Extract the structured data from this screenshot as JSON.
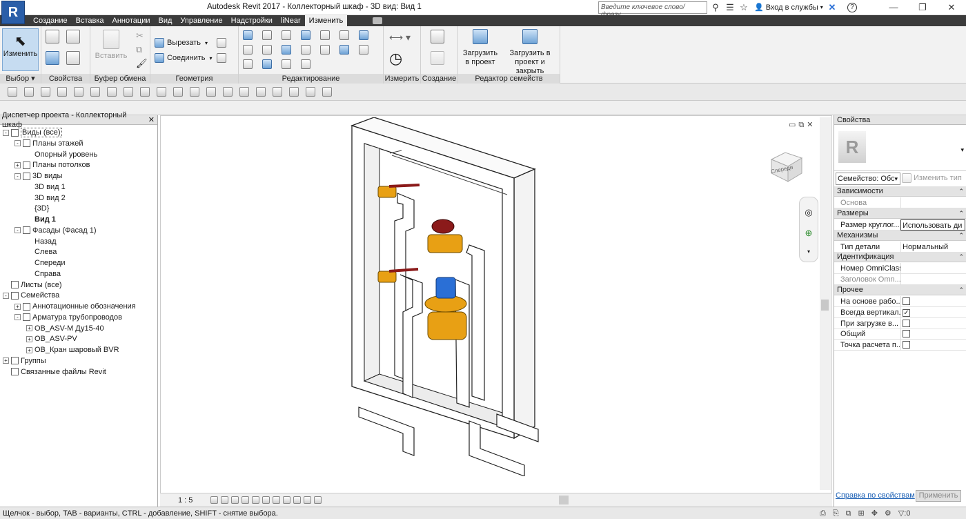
{
  "app": {
    "logo": "R",
    "title": "Autodesk Revit 2017 -      Коллекторный шкаф - 3D вид: Вид 1"
  },
  "search": {
    "placeholder": "Введите ключевое слово/фразу"
  },
  "account": {
    "login": "Вход в службы"
  },
  "tabs": [
    "Создание",
    "Вставка",
    "Аннотации",
    "Вид",
    "Управление",
    "Надстройки",
    "liNear",
    "Изменить"
  ],
  "active_tab": "Изменить",
  "ribbon": {
    "modify_label": "Изменить",
    "paste_label": "Вставить",
    "cut_label": "Вырезать",
    "join_label": "Соединить",
    "load_project_label": "Загрузить в проект",
    "load_close_label": "Загрузить в проект и закрыть",
    "panels": [
      "Выбор",
      "Свойства",
      "Буфер обмена",
      "Геометрия",
      "Редактирование",
      "Измерить",
      "Создание",
      "Редактор семейств"
    ]
  },
  "project_browser": {
    "title": "Диспетчер проекта - Коллекторный шкаф",
    "items": [
      {
        "label": "Виды (все)",
        "level": 0,
        "toggle": "-",
        "bold": false
      },
      {
        "label": "Планы этажей",
        "level": 1,
        "toggle": "-",
        "bold": false
      },
      {
        "label": "Опорный уровень",
        "level": 2,
        "toggle": "",
        "bold": false
      },
      {
        "label": "Планы потолков",
        "level": 1,
        "toggle": "+",
        "bold": false
      },
      {
        "label": "3D виды",
        "level": 1,
        "toggle": "-",
        "bold": false
      },
      {
        "label": "3D вид 1",
        "level": 2,
        "toggle": "",
        "bold": false
      },
      {
        "label": "3D вид 2",
        "level": 2,
        "toggle": "",
        "bold": false
      },
      {
        "label": "{3D}",
        "level": 2,
        "toggle": "",
        "bold": false
      },
      {
        "label": "Вид 1",
        "level": 2,
        "toggle": "",
        "bold": true
      },
      {
        "label": "Фасады (Фасад 1)",
        "level": 1,
        "toggle": "-",
        "bold": false
      },
      {
        "label": "Назад",
        "level": 2,
        "toggle": "",
        "bold": false
      },
      {
        "label": "Слева",
        "level": 2,
        "toggle": "",
        "bold": false
      },
      {
        "label": "Спереди",
        "level": 2,
        "toggle": "",
        "bold": false
      },
      {
        "label": "Справа",
        "level": 2,
        "toggle": "",
        "bold": false
      },
      {
        "label": "Листы (все)",
        "level": 0,
        "toggle": "",
        "bold": false
      },
      {
        "label": "Семейства",
        "level": 0,
        "toggle": "-",
        "bold": false
      },
      {
        "label": "Аннотационные обозначения",
        "level": 1,
        "toggle": "+",
        "bold": false
      },
      {
        "label": "Арматура трубопроводов",
        "level": 1,
        "toggle": "-",
        "bold": false
      },
      {
        "label": "ОВ_ASV-M Ду15-40",
        "level": 2,
        "toggle": "+",
        "bold": false
      },
      {
        "label": "ОВ_ASV-PV",
        "level": 2,
        "toggle": "+",
        "bold": false
      },
      {
        "label": "ОВ_Кран шаровый BVR",
        "level": 2,
        "toggle": "+",
        "bold": false
      },
      {
        "label": "Группы",
        "level": 0,
        "toggle": "+",
        "bold": false
      },
      {
        "label": "Связанные файлы Revit",
        "level": 0,
        "toggle": "",
        "bold": false
      }
    ]
  },
  "viewport": {
    "viewcube_label": "Спереди",
    "scale": "1 : 5"
  },
  "properties": {
    "title": "Свойства",
    "family_selector": "Семейство: Обо",
    "edit_type": "Изменить тип",
    "sections": [
      {
        "name": "Зависимости",
        "rows": [
          {
            "name": "Основа",
            "value": "",
            "type": "text",
            "disabled": true
          }
        ]
      },
      {
        "name": "Размеры",
        "rows": [
          {
            "name": "Размер круглог...",
            "value": "Использовать ди",
            "type": "text",
            "disabled": false
          }
        ]
      },
      {
        "name": "Механизмы",
        "rows": [
          {
            "name": "Тип детали",
            "value": "Нормальный",
            "type": "text",
            "disabled": false
          }
        ]
      },
      {
        "name": "Идентификация",
        "rows": [
          {
            "name": "Номер OmniClass",
            "value": "",
            "type": "text",
            "disabled": false
          },
          {
            "name": "Заголовок Omn...",
            "value": "",
            "type": "text",
            "disabled": true
          }
        ]
      },
      {
        "name": "Прочее",
        "rows": [
          {
            "name": "На основе рабо...",
            "value": false,
            "type": "check",
            "disabled": false
          },
          {
            "name": "Всегда вертикал...",
            "value": true,
            "type": "check",
            "disabled": false
          },
          {
            "name": "При загрузке в...",
            "value": false,
            "type": "check",
            "disabled": false
          },
          {
            "name": "Общий",
            "value": false,
            "type": "check",
            "disabled": false
          },
          {
            "name": "Точка расчета п...",
            "value": false,
            "type": "check",
            "disabled": false
          }
        ]
      }
    ],
    "help_link": "Справка по свойствам",
    "apply": "Применить"
  },
  "status": {
    "text": "Щелчок - выбор, TAB - варианты, CTRL - добавление, SHIFT - снятие выбора.",
    "filter_count": ":0"
  },
  "colors": {
    "accent": "#3d7ab8",
    "tabbar": "#3b3b3b",
    "valve_brass": "#e8a014",
    "cap_blue": "#2a6fd6",
    "cap_red": "#8b1a1a"
  }
}
